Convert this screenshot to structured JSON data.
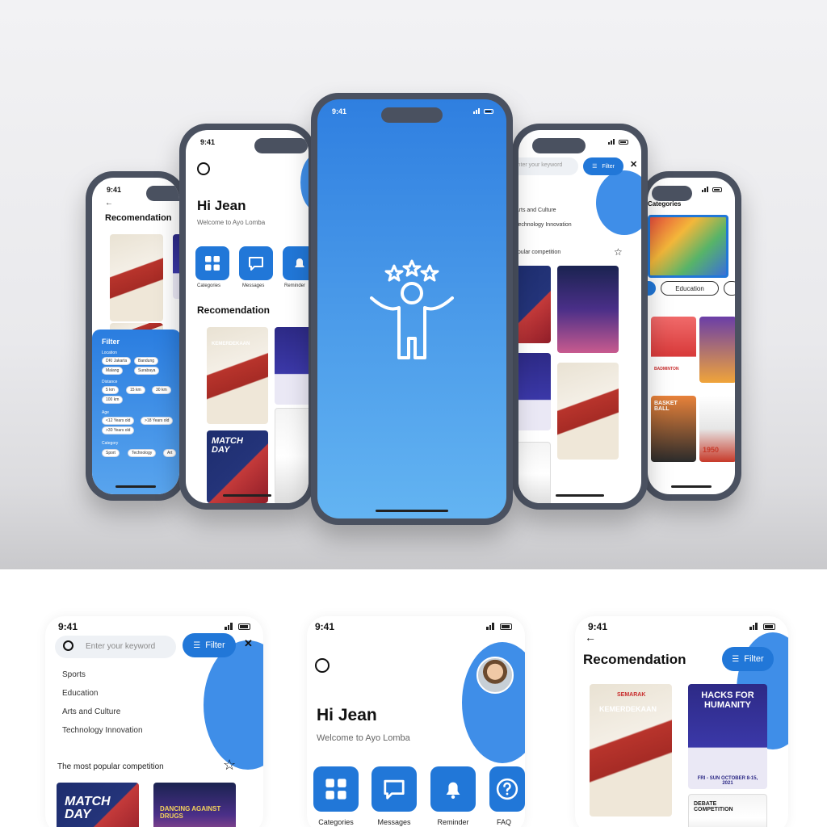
{
  "status": {
    "time_a": "9:41",
    "time_b": "9:41"
  },
  "splash": {
    "icon": "person-stars-icon",
    "bg_top": "#2f7fe0",
    "bg_bottom": "#63b4f2"
  },
  "home": {
    "greeting": "Hi Jean",
    "subtitle": "Welcome to Ayo Lomba",
    "categories": [
      {
        "label": "Categories",
        "icon": "grid-icon"
      },
      {
        "label": "Messages",
        "icon": "chat-icon"
      },
      {
        "label": "Reminder",
        "icon": "bell-icon"
      },
      {
        "label": "FAQ",
        "icon": "question-icon"
      }
    ],
    "section_title": "Recomendation"
  },
  "search": {
    "placeholder": "Enter your keyword",
    "filter_label": "Filter",
    "suggestions": [
      "Sports",
      "Education",
      "Arts and Culture",
      "Technology Innovation"
    ],
    "popular_title": "The most popular competition"
  },
  "recommendation": {
    "title": "Recomendation",
    "filter_label": "Filter"
  },
  "filter_panel": {
    "title": "Filter",
    "location_label": "Location",
    "locations": [
      "DKI Jakarta",
      "Bandung",
      "Malang",
      "Surabaya"
    ],
    "distance_label": "Distance",
    "distances": [
      "5 km",
      "15 km",
      "30 km",
      "100 km"
    ],
    "age_label": "Age",
    "ages": [
      "<12 Years old",
      ">18 Years old",
      ">30 Years old"
    ],
    "category_label": "Category",
    "categories": [
      "Sport",
      "Technology",
      "Art"
    ]
  },
  "categories_screen": {
    "title": "Categories",
    "tab": "Education",
    "poster_badge_1": "BADMINTON",
    "poster_text_2": "BASKET BALL",
    "poster_text_3": "1950"
  },
  "posters": {
    "kemerdekaan": "KEMERDEKAAN",
    "semarak": "SEMARAK",
    "hacks": "HACKS FOR HUMANITY",
    "hacks_date": "FRI - SUN OCTOBER 8-15, 2021",
    "match": "MATCH DAY",
    "dance": "DANCING AGAINST DRUGS",
    "debate": "DEBATE COMPETITION"
  },
  "colors": {
    "accent": "#2177d8",
    "blob": "#3f8ee8",
    "frame": "#4a5160"
  }
}
